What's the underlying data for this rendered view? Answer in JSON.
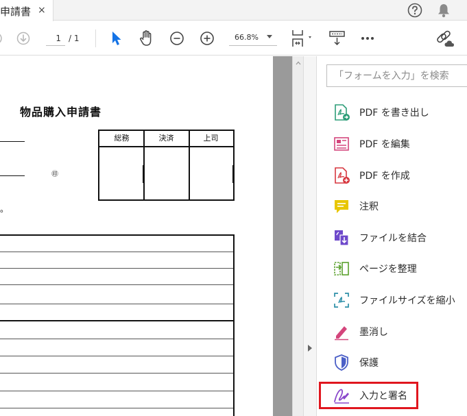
{
  "tab": {
    "title": "申請書",
    "close_glyph": "×"
  },
  "toolbar": {
    "page_current": "1",
    "page_total": "/ 1",
    "zoom": "66.8%"
  },
  "document": {
    "title": "物品購入申請書",
    "seal_mark": "㊞",
    "period_mark": "。",
    "approval_headers": [
      "総務",
      "決済",
      "上司"
    ]
  },
  "tools_pane": {
    "search_placeholder": "「フォームを入力」を検索",
    "items": [
      {
        "label": "PDF を書き出し",
        "icon": "export-pdf-icon"
      },
      {
        "label": "PDF を編集",
        "icon": "edit-pdf-icon"
      },
      {
        "label": "PDF を作成",
        "icon": "create-pdf-icon"
      },
      {
        "label": "注釈",
        "icon": "comment-icon"
      },
      {
        "label": "ファイルを結合",
        "icon": "combine-files-icon"
      },
      {
        "label": "ページを整理",
        "icon": "organize-pages-icon"
      },
      {
        "label": "ファイルサイズを縮小",
        "icon": "compress-pdf-icon"
      },
      {
        "label": "墨消し",
        "icon": "redact-icon"
      },
      {
        "label": "保護",
        "icon": "protect-icon"
      },
      {
        "label": "入力と署名",
        "icon": "fill-sign-icon",
        "highlighted": true
      }
    ]
  },
  "colors": {
    "accent_blue": "#1473e6",
    "highlight_red": "#e0161e",
    "icon_teal": "#2d9d78",
    "icon_pink": "#d7373f",
    "icon_purple": "#6e49cb",
    "icon_yellow": "#e8c600"
  }
}
